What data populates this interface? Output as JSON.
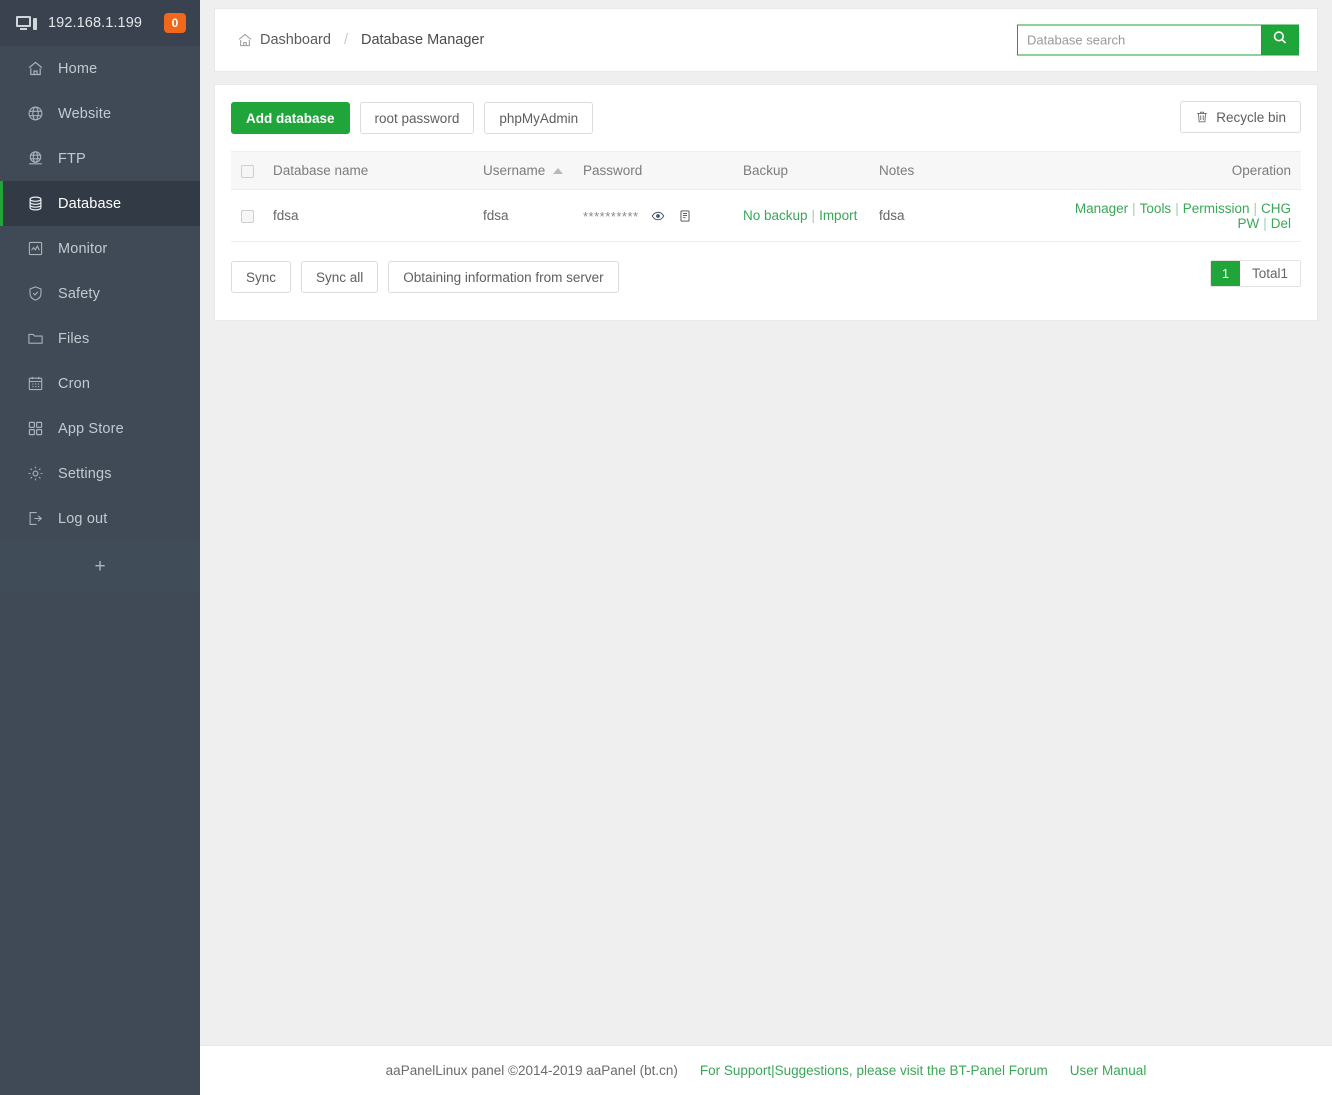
{
  "sidebar": {
    "brand": {
      "ip": "192.168.1.199",
      "badge": "0",
      "icon": "monitor-icon"
    },
    "items": [
      {
        "label": "Home",
        "icon": "home-icon"
      },
      {
        "label": "Website",
        "icon": "globe-icon"
      },
      {
        "label": "FTP",
        "icon": "ftp-globe-icon"
      },
      {
        "label": "Database",
        "icon": "database-icon",
        "active": true
      },
      {
        "label": "Monitor",
        "icon": "monitor-chart-icon"
      },
      {
        "label": "Safety",
        "icon": "shield-check-icon"
      },
      {
        "label": "Files",
        "icon": "folder-icon"
      },
      {
        "label": "Cron",
        "icon": "calendar-icon"
      },
      {
        "label": "App Store",
        "icon": "grid-icon"
      },
      {
        "label": "Settings",
        "icon": "gear-icon"
      },
      {
        "label": "Log out",
        "icon": "logout-icon"
      }
    ],
    "add_label": "+"
  },
  "header": {
    "breadcrumb_home": "Dashboard",
    "breadcrumb_sep": "/",
    "breadcrumb_current": "Database Manager",
    "home_icon": "home-icon",
    "search": {
      "placeholder": "Database search",
      "value": "",
      "button_icon": "search-icon"
    }
  },
  "toolbar": {
    "add_database": "Add database",
    "root_password": "root password",
    "phpmyadmin": "phpMyAdmin",
    "recycle_bin": "Recycle bin",
    "recycle_icon": "trash-icon"
  },
  "table": {
    "columns": {
      "select": "",
      "name": "Database name",
      "username": "Username",
      "password": "Password",
      "backup": "Backup",
      "notes": "Notes",
      "operation": "Operation"
    },
    "sort": {
      "column": "Username",
      "direction": "asc",
      "icon": "sort-asc-icon"
    },
    "rows": [
      {
        "name": "fdsa",
        "username": "fdsa",
        "password_mask": "**********",
        "password_eye_icon": "eye-icon",
        "password_copy_icon": "clipboard-icon",
        "backup_status": "No backup",
        "backup_sep": "|",
        "backup_import": "Import",
        "notes": "fdsa",
        "operations": [
          "Manager",
          "Tools",
          "Permission",
          "CHG PW",
          "Del"
        ]
      }
    ]
  },
  "bottom": {
    "sync": "Sync",
    "sync_all": "Sync all",
    "status": "Obtaining information from server",
    "page_current": "1",
    "total_label": "Total1"
  },
  "footer": {
    "copyright": "aaPanelLinux panel ©2014-2019 aaPanel (bt.cn)",
    "support_link": "For Support|Suggestions, please visit the BT-Panel Forum",
    "manual_link": "User Manual"
  },
  "colors": {
    "sidebar_bg": "#3f4a56",
    "sidebar_active_bg": "#313a45",
    "accent_green": "#20a53a",
    "link_green": "#3aa757",
    "badge_orange": "#f1681a",
    "page_bg": "#efefef"
  }
}
